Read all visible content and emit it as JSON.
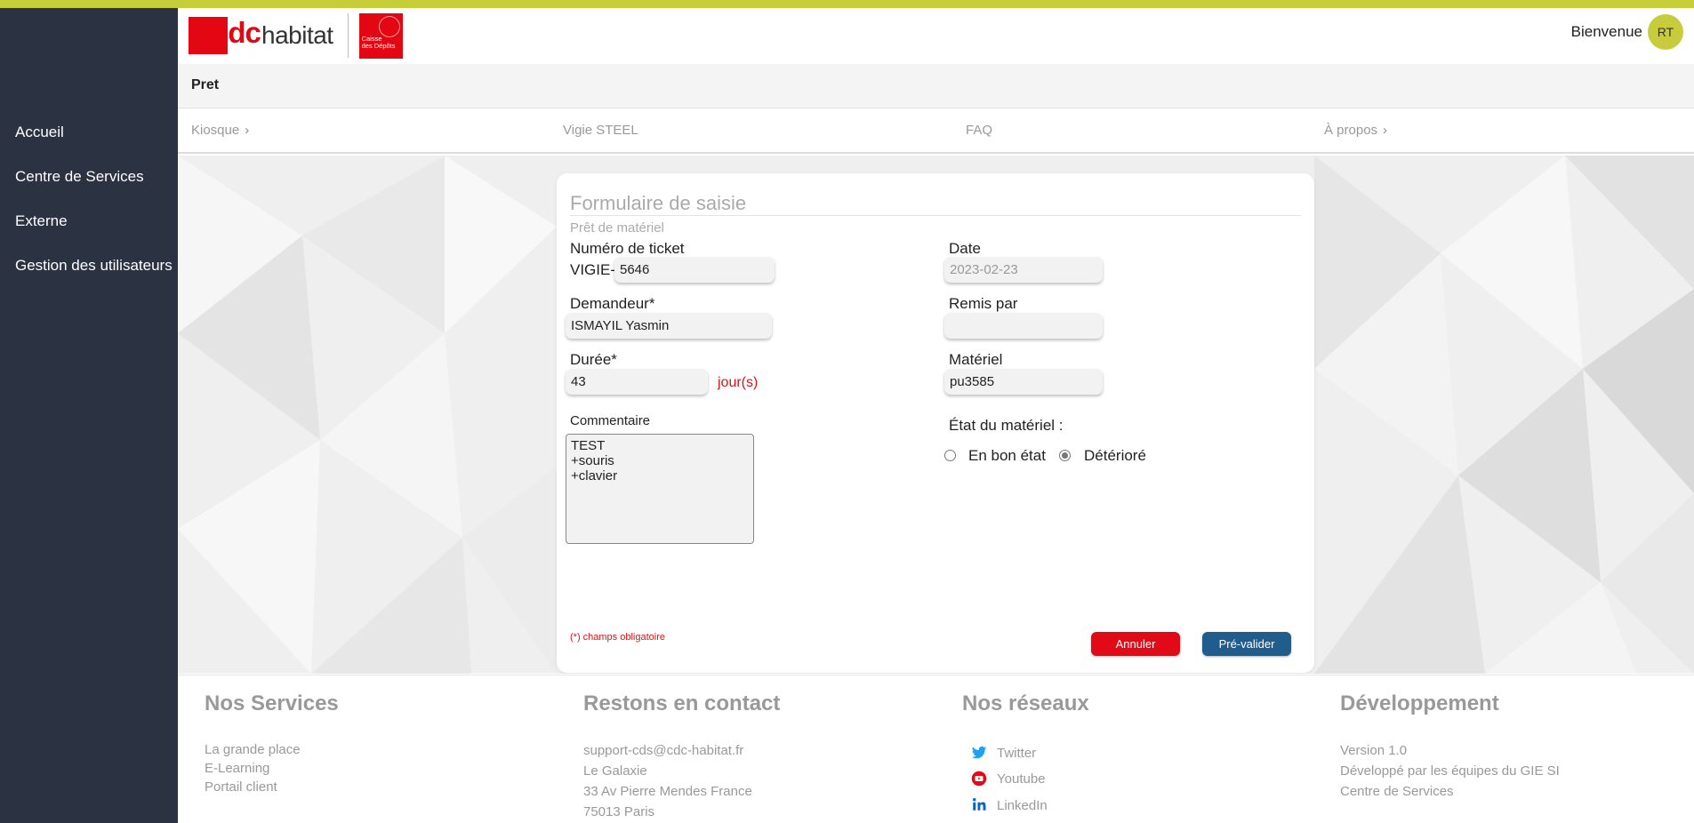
{
  "header": {
    "logo_text": "cdc habitat",
    "logo_seal_text": "Caisse des Dépôts",
    "welcome": "Bienvenue",
    "avatar_initials": "RT"
  },
  "page_title": "Pret",
  "sidebar": {
    "items": [
      {
        "label": "Accueil"
      },
      {
        "label": "Centre de Services"
      },
      {
        "label": "Externe"
      },
      {
        "label": "Gestion des utilisateurs"
      }
    ]
  },
  "nav": {
    "items": [
      {
        "label": "Kiosque"
      },
      {
        "label": "Vigie STEEL"
      },
      {
        "label": "FAQ"
      },
      {
        "label": "À propos"
      }
    ]
  },
  "form": {
    "title": "Formulaire de saisie",
    "subtitle": "Prêt de matériel",
    "ticket_label": "Numéro de ticket",
    "ticket_prefix": "VIGIE-",
    "ticket_value": "5646",
    "date_label": "Date",
    "date_value": "2023-02-23",
    "requester_label": "Demandeur*",
    "requester_value": "ISMAYIL Yasmin",
    "handed_by_label": "Remis par",
    "handed_by_value": "",
    "duration_label": "Durée*",
    "duration_value": "43",
    "duration_unit": "jour(s)",
    "material_label": "Matériel",
    "material_value": "pu3585",
    "comment_label": "Commentaire",
    "comment_value": "TEST\n+souris\n+clavier",
    "condition_label": "État du matériel :",
    "condition_options": [
      {
        "label": "En bon état",
        "checked": false
      },
      {
        "label": "Détérioré",
        "checked": true
      }
    ],
    "required_note": "(*) champs obligatoire",
    "cancel_label": "Annuler",
    "validate_label": "Pré-valider"
  },
  "footer": {
    "services": {
      "title": "Nos Services",
      "links": [
        "La grande place",
        "E-Learning",
        "Portail client"
      ]
    },
    "contact": {
      "title": "Restons en contact",
      "lines": [
        "support-cds@cdc-habitat.fr",
        "Le Galaxie",
        "33 Av Pierre Mendes France",
        "75013 Paris"
      ]
    },
    "networks": {
      "title": "Nos réseaux",
      "links": [
        {
          "label": "Twitter",
          "icon": "twitter-icon",
          "color": "#1da1f2"
        },
        {
          "label": "Youtube",
          "icon": "youtube-icon",
          "color": "#e20a17"
        },
        {
          "label": "LinkedIn",
          "icon": "linkedin-icon",
          "color": "#0a66c2"
        }
      ]
    },
    "dev": {
      "title": "Développement",
      "lines": [
        "Version 1.0",
        "Développé par les équipes du GIE SI",
        "Centre de Services"
      ]
    }
  },
  "colors": {
    "brand_red": "#e30613",
    "accent_lime": "#c5cd38",
    "sidebar_bg": "#2b3241",
    "validate_blue": "#1f5e8c"
  }
}
